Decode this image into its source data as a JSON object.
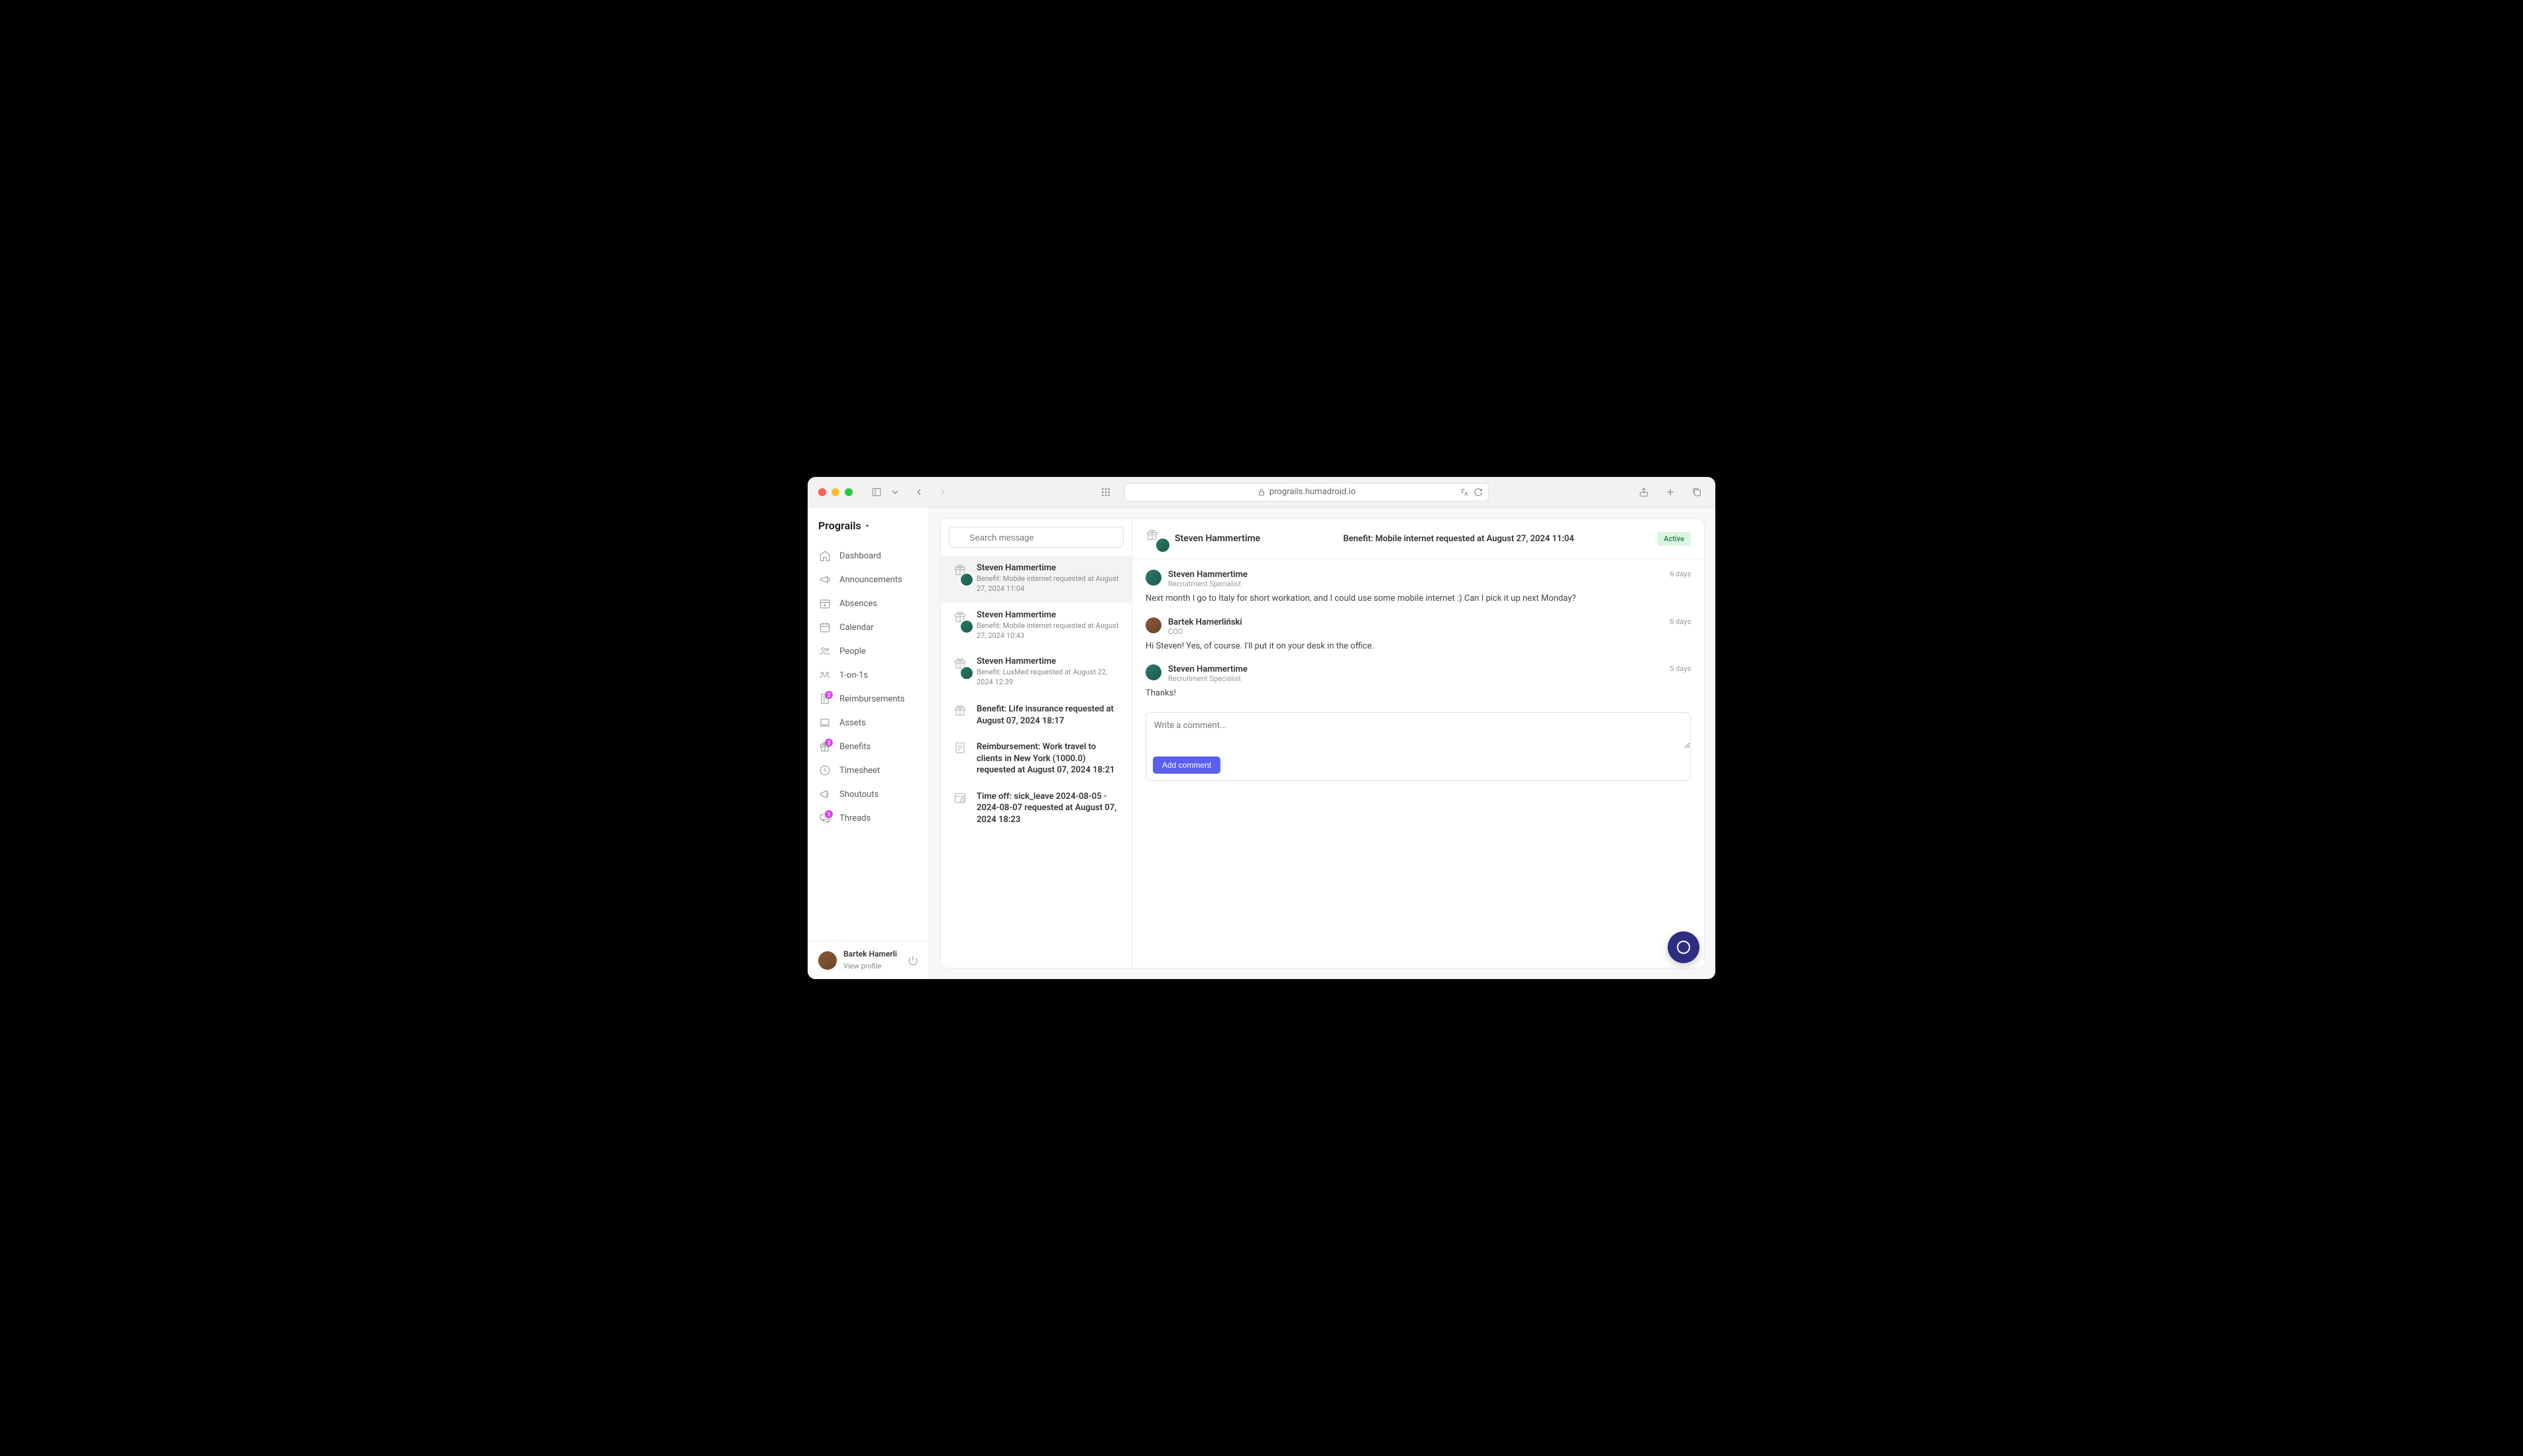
{
  "browser": {
    "url": "prograils.humadroid.io"
  },
  "workspace": {
    "name": "Prograils"
  },
  "nav": [
    {
      "label": "Dashboard",
      "icon": "home",
      "badge": null
    },
    {
      "label": "Announcements",
      "icon": "megaphone",
      "badge": null
    },
    {
      "label": "Absences",
      "icon": "calendar-plus",
      "badge": null
    },
    {
      "label": "Calendar",
      "icon": "calendar",
      "badge": null
    },
    {
      "label": "People",
      "icon": "people",
      "badge": null
    },
    {
      "label": "1-on-1s",
      "icon": "chat-group",
      "badge": null
    },
    {
      "label": "Reimbursements",
      "icon": "receipt",
      "badge": "2"
    },
    {
      "label": "Assets",
      "icon": "laptop",
      "badge": null
    },
    {
      "label": "Benefits",
      "icon": "gift",
      "badge": "3"
    },
    {
      "label": "Timesheet",
      "icon": "clock",
      "badge": null
    },
    {
      "label": "Shoutouts",
      "icon": "announce",
      "badge": null
    },
    {
      "label": "Threads",
      "icon": "thread",
      "badge": "1"
    }
  ],
  "current_user": {
    "name": "Bartek Hamerli",
    "profile_link": "View profile"
  },
  "search": {
    "placeholder": "Search message"
  },
  "threads": [
    {
      "icon": "gift",
      "has_avatar": true,
      "name": "Steven Hammertime",
      "preview": "Benefit: Mobile internet requested at August 27, 2024 11:04",
      "active": true
    },
    {
      "icon": "gift",
      "has_avatar": true,
      "name": "Steven Hammertime",
      "preview": "Benefit: Mobile internet requested at August 27, 2024 10:43",
      "active": false
    },
    {
      "icon": "gift",
      "has_avatar": true,
      "name": "Steven Hammertime",
      "preview": "Benefit: LuxMed requested at August 22, 2024 12:39",
      "active": false
    },
    {
      "icon": "gift",
      "has_avatar": false,
      "name": "",
      "preview": "Benefit: Life insurance requested at August 07, 2024 18:17",
      "active": false
    },
    {
      "icon": "receipt",
      "has_avatar": false,
      "name": "",
      "preview": "Reimbursement: Work travel to clients in New York (1000.0) requested at August 07, 2024 18:21",
      "active": false
    },
    {
      "icon": "calendar-clock",
      "has_avatar": false,
      "name": "",
      "preview": "Time off: sick_leave 2024-08-05 - 2024-08-07 requested at August 07, 2024 18:23",
      "active": false
    }
  ],
  "conversation": {
    "header_name": "Steven Hammertime",
    "header_title": "Benefit: Mobile internet requested at August 27, 2024 11:04",
    "status": "Active",
    "messages": [
      {
        "avatar": "steven",
        "name": "Steven Hammertime",
        "role": "Recruitment Specialist",
        "time": "6 days",
        "body": "Next month I go to Italy for short workation, and I could use some mobile internet :) Can I pick it up next Monday?"
      },
      {
        "avatar": "bartek",
        "name": "Bartek Hamerliński",
        "role": "COO",
        "time": "6 days",
        "body": "Hi Steven! Yes, of course. I'll put it on your desk in the office."
      },
      {
        "avatar": "steven",
        "name": "Steven Hammertime",
        "role": "Recruitment Specialist",
        "time": "5 days",
        "body": "Thanks!"
      }
    ],
    "comment_placeholder": "Write a comment...",
    "add_comment_label": "Add comment"
  }
}
